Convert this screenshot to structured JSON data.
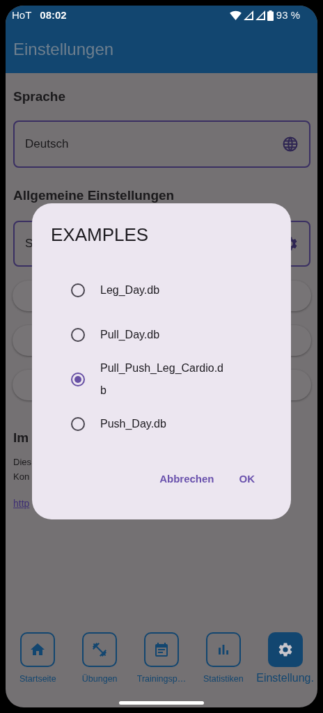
{
  "status_bar": {
    "carrier": "HoT",
    "time": "08:02",
    "battery": "93 %"
  },
  "app_bar": {
    "title": "Einstellungen"
  },
  "settings": {
    "language_heading": "Sprache",
    "language_field": {
      "value": "Deutsch"
    },
    "general_heading": "Allgemeine Einstellungen",
    "general_field": {
      "value": "S"
    },
    "imprint_heading": "Im",
    "imprint_lines": [
      "Dies",
      "Kon"
    ],
    "link": "http"
  },
  "dialog": {
    "title": "EXAMPLES",
    "options": [
      {
        "label": "Leg_Day.db",
        "selected": false
      },
      {
        "label": "Pull_Day.db",
        "selected": false
      },
      {
        "label": "Pull_Push_Leg_Cardio.db",
        "selected": true
      },
      {
        "label": "Push_Day.db",
        "selected": false
      }
    ],
    "buttons": [
      "Abbrechen",
      "OK"
    ]
  },
  "bottom_nav": [
    {
      "kind": "home",
      "label": "Startseite",
      "selected": false
    },
    {
      "kind": "dumbbell",
      "label": "Übungen",
      "selected": false
    },
    {
      "kind": "calendar",
      "label": "Trainingsp…",
      "selected": false
    },
    {
      "kind": "chart",
      "label": "Statistiken",
      "selected": false
    },
    {
      "kind": "gear",
      "label": "Einstellung.",
      "selected": true
    }
  ]
}
